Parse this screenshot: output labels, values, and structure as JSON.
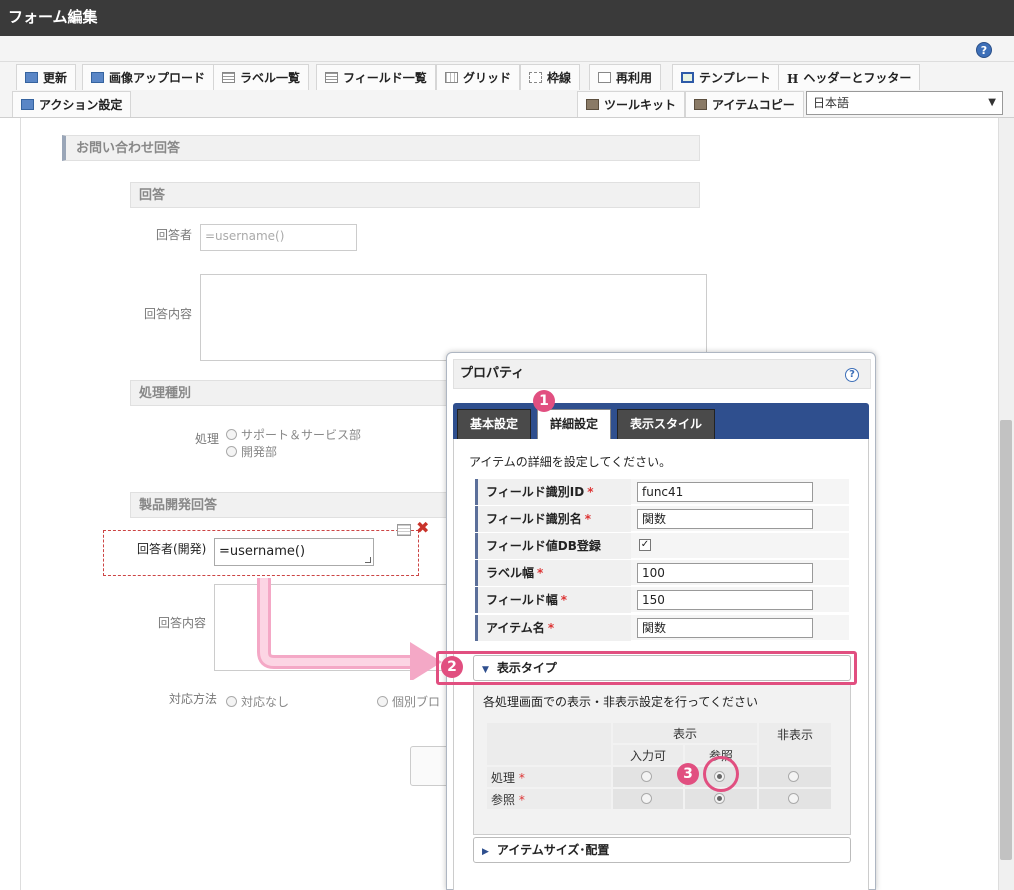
{
  "window": {
    "title": "フォーム編集"
  },
  "toolbar": {
    "row1": [
      {
        "label": "更新",
        "icon": "refresh-icon"
      },
      {
        "label": "画像アップロード",
        "icon": "image-upload-icon"
      },
      {
        "label": "ラベル一覧",
        "icon": "label-list-icon"
      },
      {
        "label": "フィールド一覧",
        "icon": "field-list-icon"
      },
      {
        "label": "グリッド",
        "icon": "grid-icon"
      },
      {
        "label": "枠線",
        "icon": "border-icon"
      },
      {
        "label": "再利用",
        "icon": "reuse-icon"
      },
      {
        "label": "テンプレート",
        "icon": "template-icon"
      },
      {
        "label": "ヘッダーとフッター",
        "icon": "header-footer-icon"
      }
    ],
    "row2": [
      {
        "label": "アクション設定",
        "icon": "action-icon"
      },
      {
        "label": "ツールキット",
        "icon": "toolkit-icon"
      },
      {
        "label": "アイテムコピー",
        "icon": "item-copy-icon"
      }
    ],
    "language": "日本語",
    "help": "?"
  },
  "form": {
    "section_title": "お問い合わせ回答",
    "answer_header": "回答",
    "responder_label": "回答者",
    "responder_value": "=username()",
    "content_label": "回答内容",
    "process_header": "処理種別",
    "process_label": "処理",
    "process_options": [
      "サポート＆サービス部",
      "開発部"
    ],
    "dev_header": "製品開発回答",
    "dev_responder_label": "回答者(開発)",
    "dev_responder_value": "=username()",
    "dev_content_label": "回答内容",
    "method_label": "対応方法",
    "method_options": [
      "対応なし",
      "個別ブロ"
    ]
  },
  "property_panel": {
    "title": "プロパティ",
    "help": "?",
    "tabs": [
      "基本設定",
      "詳細設定",
      "表示スタイル"
    ],
    "active_tab": "詳細設定",
    "description": "アイテムの詳細を設定してください。",
    "fields": [
      {
        "label": "フィールド識別ID",
        "required": true,
        "value": "func41"
      },
      {
        "label": "フィールド識別名",
        "required": true,
        "value": "関数"
      },
      {
        "label": "フィールド値DB登録",
        "required": false,
        "checked": true,
        "check_mark": "✓"
      },
      {
        "label": "ラベル幅",
        "required": true,
        "value": "100"
      },
      {
        "label": "フィールド幅",
        "required": true,
        "value": "150"
      },
      {
        "label": "アイテム名",
        "required": true,
        "value": "関数"
      }
    ],
    "display_type": {
      "title": "表示タイプ",
      "description": "各処理画面での表示・非表示設定を行ってください",
      "col_show": "表示",
      "col_hide": "非表示",
      "col_input": "入力可",
      "col_ref": "参照",
      "rows": [
        {
          "label": "処理",
          "selected": "参照"
        },
        {
          "label": "参照",
          "selected": "参照"
        }
      ]
    },
    "size_section": "アイテムサイズ･配置"
  },
  "callouts": [
    "1",
    "2",
    "3"
  ],
  "colors": {
    "accent": "#e14f80",
    "tab_bar": "#2f4f8e",
    "title_bar": "#3a3a3a"
  }
}
